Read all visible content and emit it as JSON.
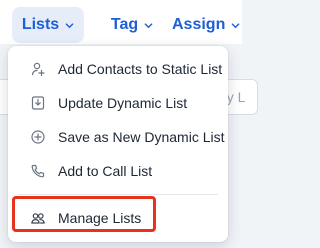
{
  "toolbar": {
    "lists_label": "Lists",
    "tag_label": "Tag",
    "assign_label": "Assign"
  },
  "background": {
    "right_field_text": "by L"
  },
  "menu": {
    "items": [
      {
        "label": "Add Contacts to Static List",
        "icon": "add-contact-icon"
      },
      {
        "label": "Update Dynamic List",
        "icon": "download-file-icon"
      },
      {
        "label": "Save as New Dynamic List",
        "icon": "plus-circle-icon"
      },
      {
        "label": "Add to Call List",
        "icon": "phone-icon"
      },
      {
        "label": "Manage Lists",
        "icon": "users-icon"
      }
    ]
  },
  "colors": {
    "accent": "#1f5fd6",
    "highlight": "#e8321c"
  }
}
